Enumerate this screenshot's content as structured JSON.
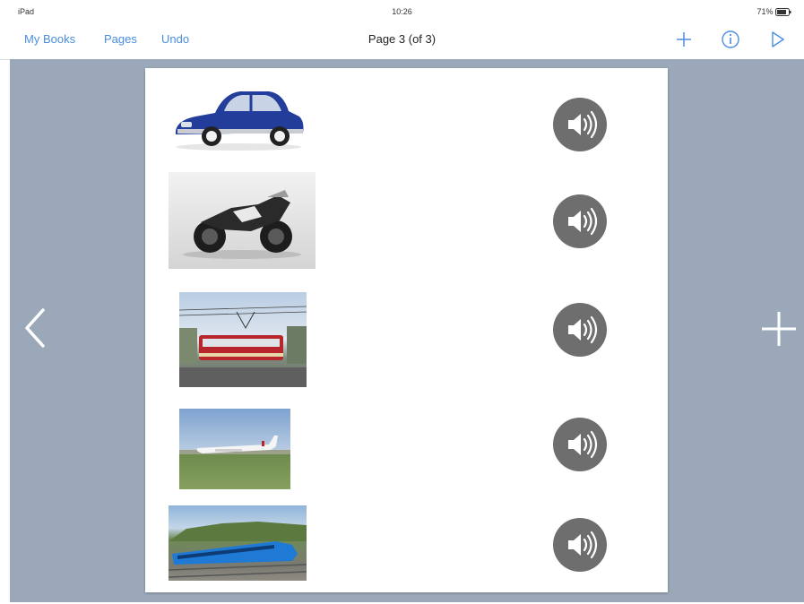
{
  "status_bar": {
    "carrier": "iPad",
    "time": "10:26",
    "battery": "71%"
  },
  "nav": {
    "my_books": "My Books",
    "pages": "Pages",
    "undo": "Undo",
    "title": "Page 3 (of 3)",
    "icons": [
      "plus-icon",
      "info-icon",
      "play-icon"
    ]
  },
  "items": [
    {
      "picture": "blue-vintage-car",
      "audio_icon": "speaker-icon"
    },
    {
      "picture": "black-motorcycle",
      "audio_icon": "speaker-icon"
    },
    {
      "picture": "red-tram",
      "audio_icon": "speaker-icon"
    },
    {
      "picture": "white-airplane",
      "audio_icon": "speaker-icon"
    },
    {
      "picture": "blue-train",
      "audio_icon": "speaker-icon"
    }
  ],
  "colors": {
    "accent": "#4a8ee0",
    "canvas_background": "#9aa8b9",
    "speaker_button": "#6e6e6e"
  }
}
